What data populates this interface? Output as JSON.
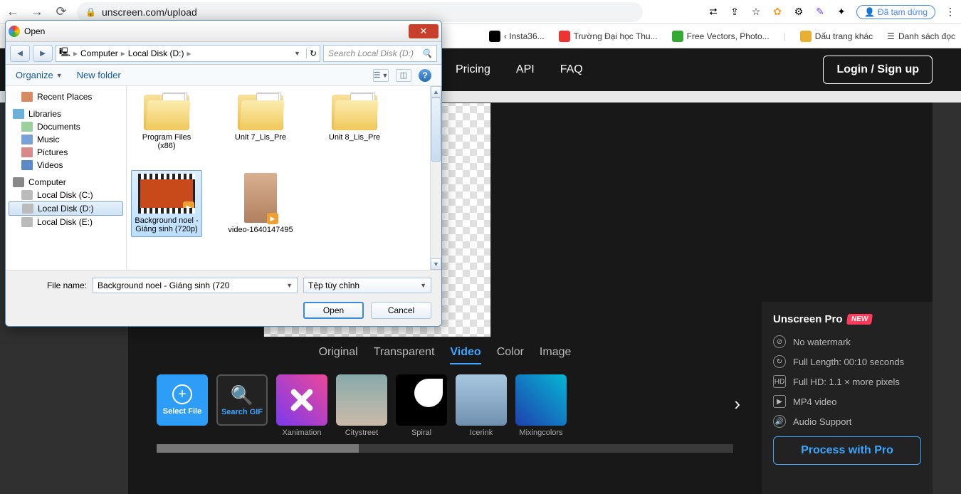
{
  "browser": {
    "url": "unscreen.com/upload",
    "pause_label": "Đã tạm dừng",
    "bookmarks": [
      {
        "label": "‹ Insta36..."
      },
      {
        "label": "Trường Đại học Thu..."
      },
      {
        "label": "Free Vectors, Photo..."
      }
    ],
    "bookmark_other": "Dấu trang khác",
    "reading_list": "Danh sách đọc"
  },
  "site": {
    "nav": [
      "Pricing",
      "API",
      "FAQ"
    ],
    "login": "Login / Sign up",
    "tabs": [
      "Original",
      "Transparent",
      "Video",
      "Color",
      "Image"
    ],
    "active_tab": "Video",
    "select_file": "Select File",
    "search_gif": "Search GIF",
    "thumbs": [
      "Xanimation",
      "Citystreet",
      "Spiral",
      "Icerink",
      "Mixingcolors"
    ]
  },
  "pro": {
    "title": "Unscreen Pro",
    "badge": "NEW",
    "features": [
      "No watermark",
      "Full Length: 00:10 seconds",
      "Full HD: 1.1 × more pixels",
      "MP4 video",
      "Audio Support"
    ],
    "button": "Process with Pro"
  },
  "dialog": {
    "title": "Open",
    "breadcrumb": [
      "Computer",
      "Local Disk (D:)"
    ],
    "search_placeholder": "Search Local Disk (D:)",
    "organize": "Organize",
    "new_folder": "New folder",
    "sidebar": {
      "recent": "Recent Places",
      "libraries": "Libraries",
      "docs": "Documents",
      "music": "Music",
      "pics": "Pictures",
      "videos": "Videos",
      "computer": "Computer",
      "disk_c": "Local Disk (C:)",
      "disk_d": "Local Disk (D:)",
      "disk_e": "Local Disk (E:)"
    },
    "files": {
      "f1": "Program Files (x86)",
      "f2": "Unit 7_Lis_Pre",
      "f3": "Unit 8_Lis_Pre",
      "v1": "Background noel - Giáng sinh (720p)",
      "v2": "video-1640147495"
    },
    "filename_label": "File name:",
    "filename_value": "Background noel - Giáng sinh (720",
    "filetype": "Tệp tùy chỉnh",
    "open_btn": "Open",
    "cancel_btn": "Cancel"
  }
}
